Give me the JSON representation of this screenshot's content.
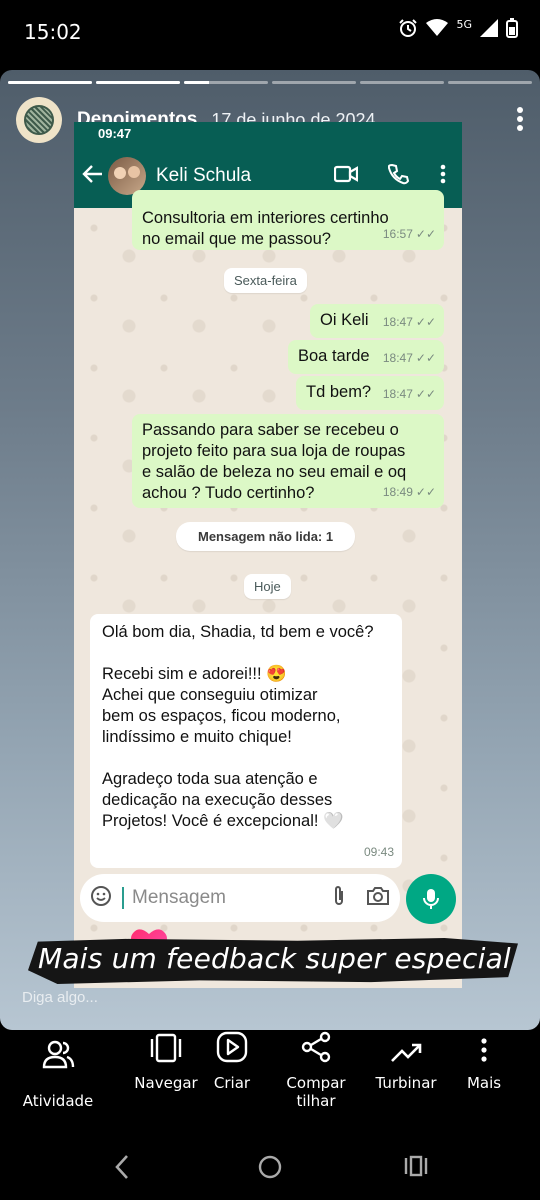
{
  "status_bar": {
    "time": "15:02",
    "network": "5G",
    "icons": [
      "alarm-icon",
      "wifi-icon",
      "signal-icon",
      "battery-icon"
    ]
  },
  "story": {
    "account_name": "Depoimentos",
    "date": "17 de junho de 2024",
    "progress_segments": [
      1,
      1,
      0.3,
      0,
      0,
      0
    ],
    "caption": "Mais um feedback super especial",
    "reply_placeholder": "Diga algo..."
  },
  "whatsapp": {
    "status_time": "09:47",
    "contact_name": "Keli Schula",
    "messages": [
      {
        "type": "outgoing",
        "text": "Consultoria em interiores  certinho\nno email que me passou?",
        "time": "16:57"
      },
      {
        "type": "date_chip",
        "text": "Sexta-feira"
      },
      {
        "type": "outgoing",
        "text": "Oi Keli",
        "time": "18:47"
      },
      {
        "type": "outgoing",
        "text": "Boa tarde",
        "time": "18:47"
      },
      {
        "type": "outgoing",
        "text": "Td bem?",
        "time": "18:47"
      },
      {
        "type": "outgoing",
        "text": "Passando para saber se recebeu o\nprojeto  feito para sua loja de roupas\ne salão de beleza no seu email e oq\nachou ? Tudo  certinho?",
        "time": "18:49"
      },
      {
        "type": "unread_chip",
        "text": "Mensagem não lida: 1"
      },
      {
        "type": "date_chip",
        "text": "Hoje"
      },
      {
        "type": "incoming",
        "text": "Olá bom dia, Shadia, td bem e você?\n\nRecebi sim e adorei!!! 😍\nAchei que conseguiu otimizar\nbem os espaços, ficou moderno,\nlindíssimo e muito chique!\n\nAgradeço toda sua atenção e\ndedicação na execução desses\nProjetos! Você é excepcional! 🤍",
        "time": "09:43"
      }
    ],
    "composer_placeholder": "Mensagem"
  },
  "actions": [
    {
      "label": "Atividade",
      "icon": "people-icon"
    },
    {
      "label": "Navegar",
      "icon": "carousel-icon"
    },
    {
      "label": "Criar",
      "icon": "play-icon"
    },
    {
      "label": "Compar\ntilhar",
      "icon": "share-icon"
    },
    {
      "label": "Turbinar",
      "icon": "trend-icon"
    },
    {
      "label": "Mais",
      "icon": "more-vertical-icon"
    }
  ],
  "colors": {
    "wa_header": "#075e54",
    "outgoing_bubble": "#dcf8c6",
    "mic_button": "#00a884",
    "heart": "#ff3d7f"
  }
}
